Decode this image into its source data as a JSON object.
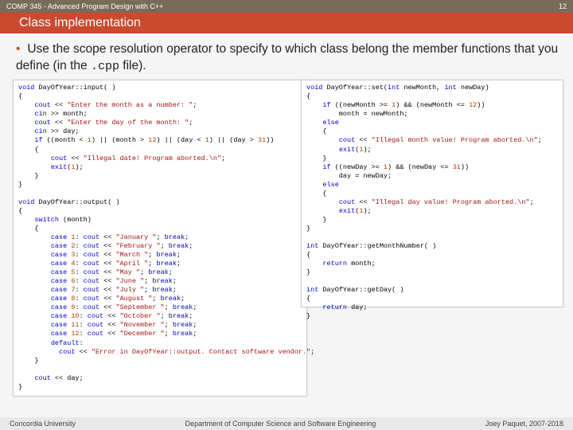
{
  "header": {
    "course": "COMP 345 - Advanced Program Design with C++",
    "slide_number": "12",
    "title": "Class implementation"
  },
  "body": {
    "bullet_pre": "Use the scope resolution operator to specify to which class belong the member functions that you define (in the ",
    "bullet_code": ".cpp",
    "bullet_post": " file)."
  },
  "code": {
    "left": "void DayOfYear::input( )\n{\n    cout << \"Enter the month as a number: \";\n    cin >> month;\n    cout << \"Enter the day of the month: \";\n    cin >> day;\n    if ((month < 1) || (month > 12) || (day < 1) || (day > 31))\n    {\n        cout << \"Illegal date! Program aborted.\\n\";\n        exit(1);\n    }\n}\n\nvoid DayOfYear::output( )\n{\n    switch (month)\n    {\n        case 1: cout << \"January \"; break;\n        case 2: cout << \"February \"; break;\n        case 3: cout << \"March \"; break;\n        case 4: cout << \"April \"; break;\n        case 5: cout << \"May \"; break;\n        case 6: cout << \"June \"; break;\n        case 7: cout << \"July \"; break;\n        case 8: cout << \"August \"; break;\n        case 9: cout << \"September \"; break;\n        case 10: cout << \"October \"; break;\n        case 11: cout << \"November \"; break;\n        case 12: cout << \"December \"; break;\n        default:\n          cout << \"Error in DayOfYear::output. Contact software vendor.\";\n    }\n\n    cout << day;\n}",
    "right": "void DayOfYear::set(int newMonth, int newDay)\n{\n    if ((newMonth >= 1) && (newMonth <= 12))\n        month = newMonth;\n    else\n    {\n        cout << \"Illegal month value! Program aborted.\\n\";\n        exit(1);\n    }\n    if ((newDay >= 1) && (newDay <= 31))\n        day = newDay;\n    else\n    {\n        cout << \"Illegal day value! Program aborted.\\n\";\n        exit(1);\n    }\n}\n\nint DayOfYear::getMonthNumber( )\n{\n    return month;\n}\n\nint DayOfYear::getDay( )\n{\n    return day;\n}"
  },
  "footer": {
    "left": "Concordia University",
    "center": "Department of Computer Science and Software Engineering",
    "right": "Joey Paquet, 2007-2018"
  }
}
